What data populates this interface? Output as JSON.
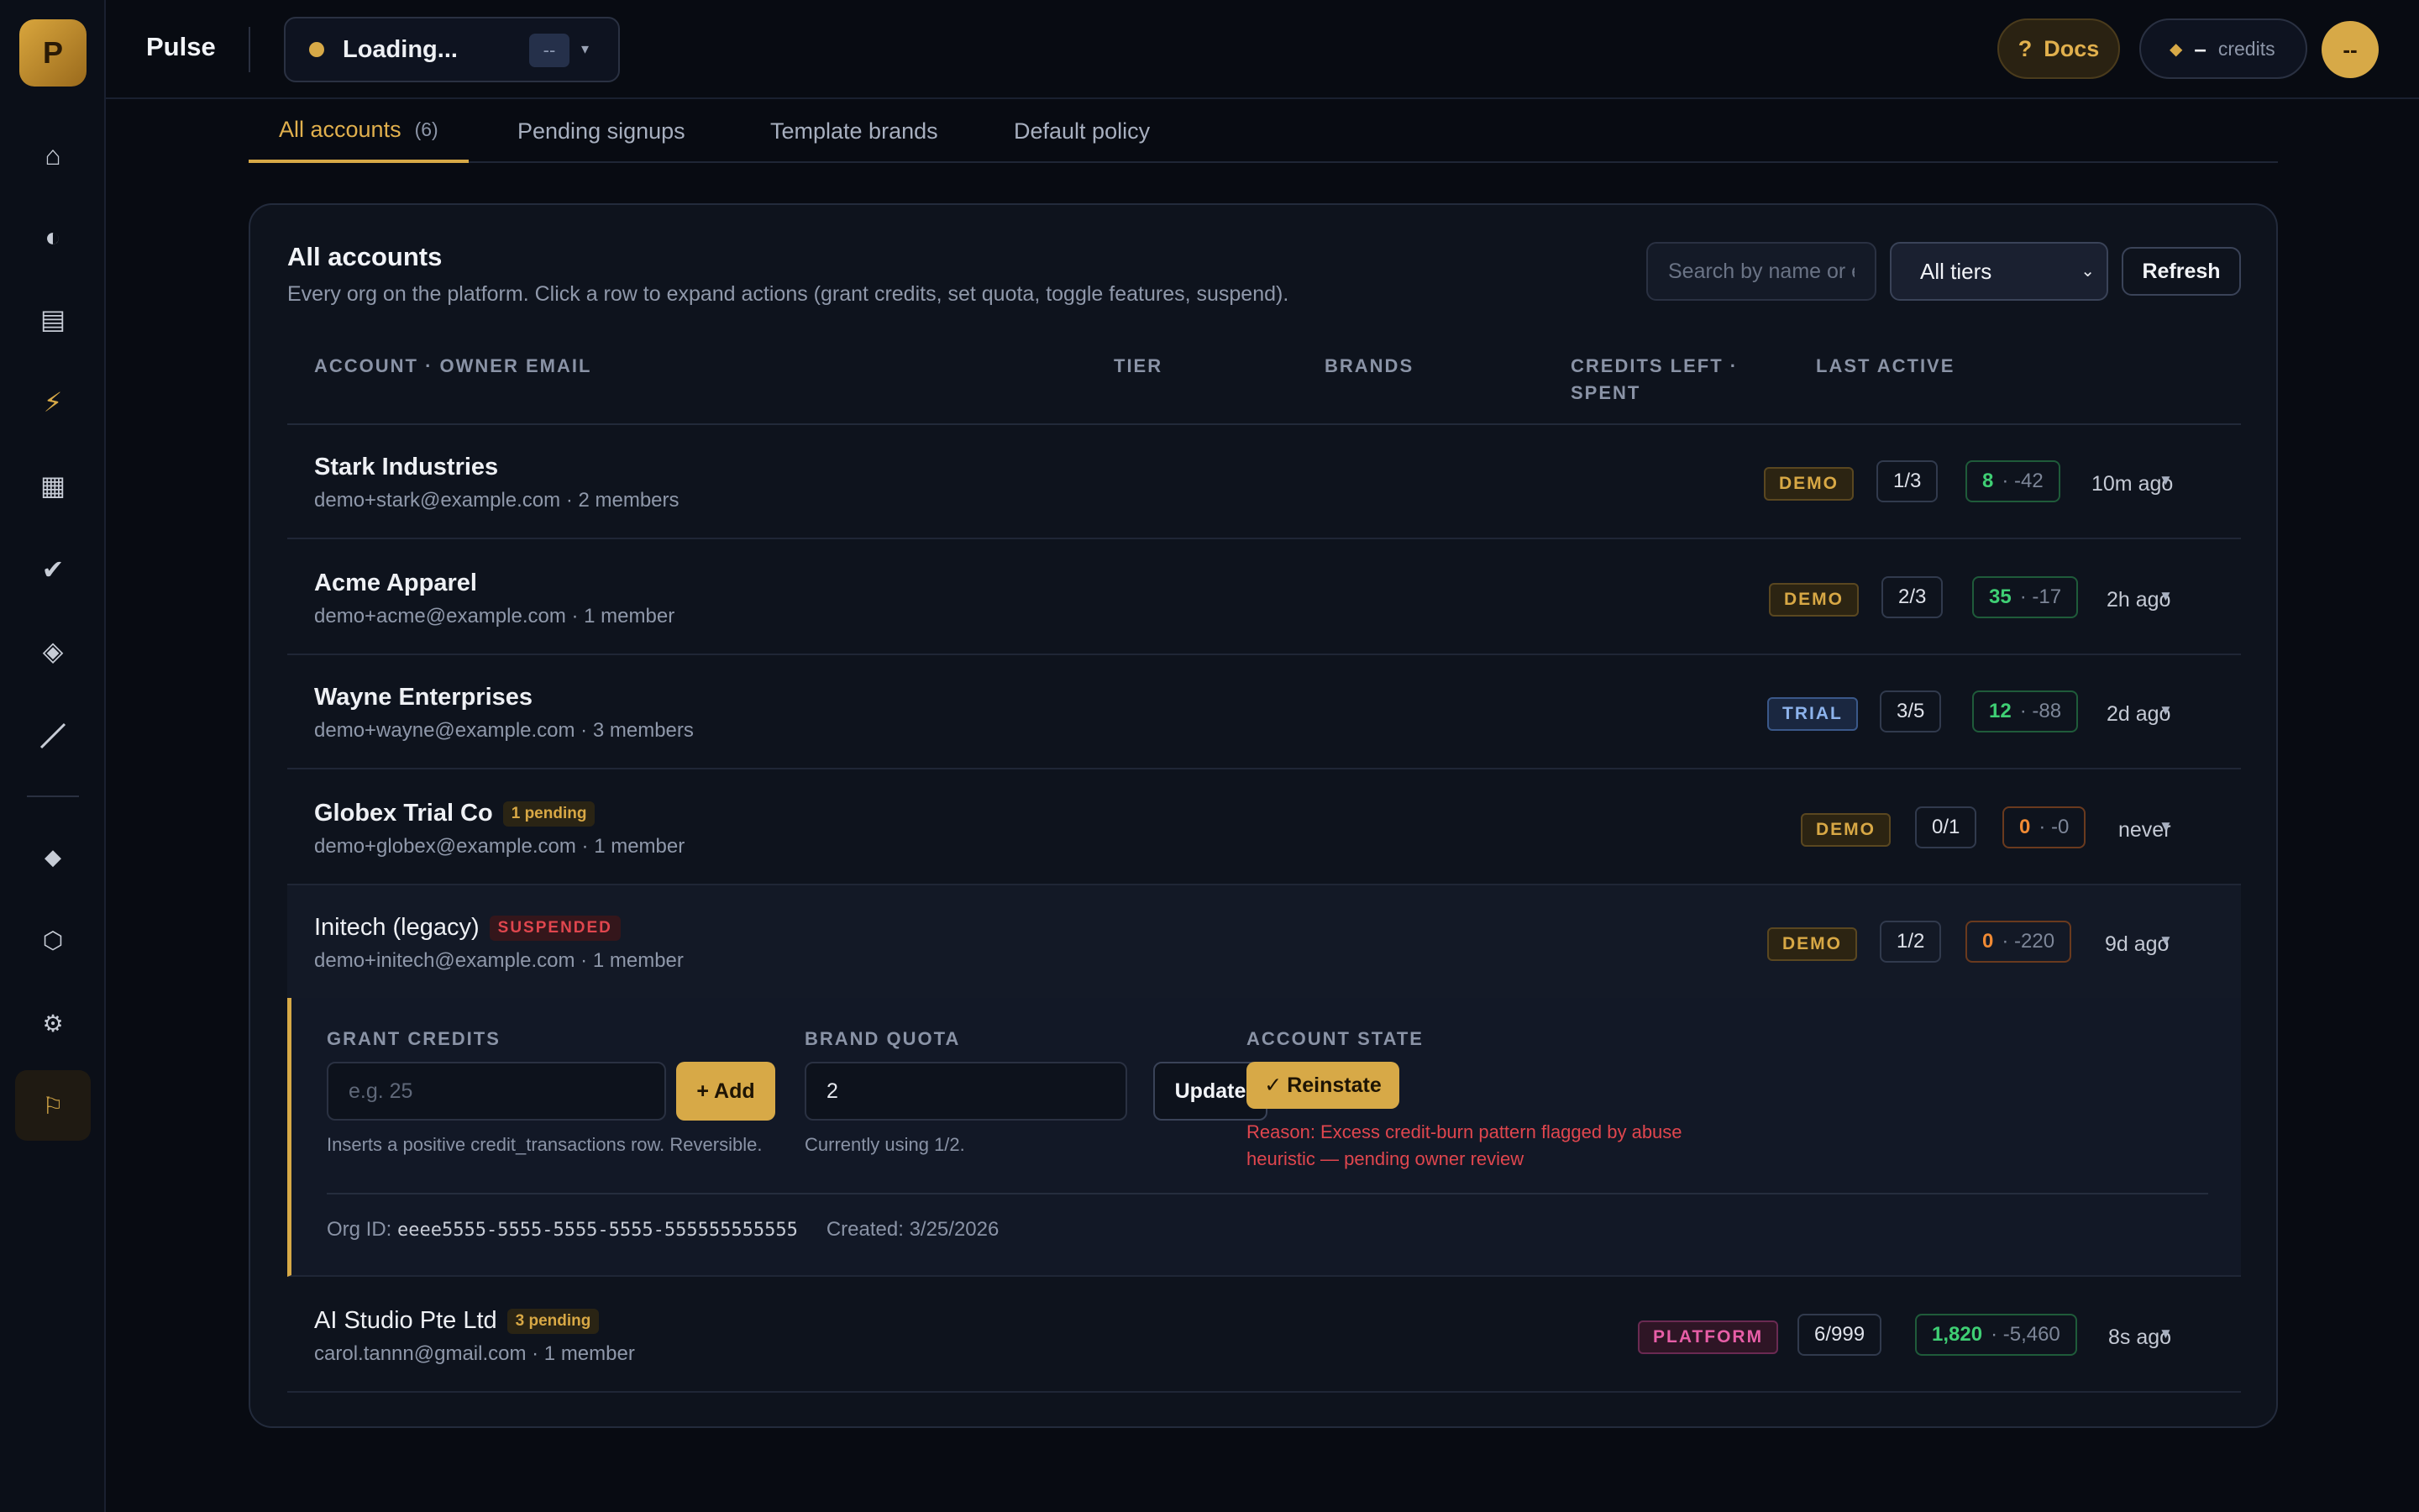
{
  "app": {
    "logo_letter": "P",
    "name": "Pulse"
  },
  "env": {
    "label": "Loading...",
    "badge": "--"
  },
  "topbar": {
    "docs_icon": "?",
    "docs_label": "Docs",
    "credits_value": "–",
    "credits_label": "credits",
    "avatar": "--"
  },
  "sidebar": {
    "icons": [
      "home-icon",
      "contrast-icon",
      "table-icon",
      "bolt-icon",
      "grid-icon",
      "check-icon",
      "layers-icon",
      "arrow-icon",
      "diamond-icon",
      "hexagon-icon",
      "gear-icon",
      "flag-icon"
    ],
    "active": "flag-icon"
  },
  "tabs": [
    {
      "label": "All accounts",
      "count": "(6)"
    },
    {
      "label": "Pending signups"
    },
    {
      "label": "Template brands"
    },
    {
      "label": "Default policy"
    }
  ],
  "card": {
    "title": "All accounts",
    "subtitle": "Every org on the platform. Click a row to expand actions (grant credits, set quota, toggle features, suspend).",
    "search_placeholder": "Search by name or email",
    "tier_filter": "All tiers",
    "refresh_label": "Refresh"
  },
  "columns": {
    "account": "ACCOUNT · OWNER EMAIL",
    "tier": "TIER",
    "brands": "BRANDS",
    "credits_l1": "CREDITS LEFT ·",
    "credits_l2": "SPENT",
    "last_active": "LAST ACTIVE"
  },
  "rows": [
    {
      "name": "Stark Industries",
      "email": "demo+stark@example.com · 2 members",
      "tier": "DEMO",
      "brands": "1/3",
      "credits_left": "8",
      "credits_spent": "· -42",
      "last_active": "10m ago"
    },
    {
      "name": "Acme Apparel",
      "email": "demo+acme@example.com · 1 member",
      "tier": "DEMO",
      "brands": "2/3",
      "credits_left": "35",
      "credits_spent": "· -17",
      "last_active": "2h ago"
    },
    {
      "name": "Wayne Enterprises",
      "email": "demo+wayne@example.com · 3 members",
      "tier": "TRIAL",
      "brands": "3/5",
      "credits_left": "12",
      "credits_spent": "· -88",
      "last_active": "2d ago"
    },
    {
      "name": "Globex Trial Co",
      "badge": "1 pending",
      "email": "demo+globex@example.com · 1 member",
      "tier": "DEMO",
      "brands": "0/1",
      "credits_left": "0",
      "credits_spent": "· -0",
      "last_active": "never"
    },
    {
      "name": "Initech (legacy)",
      "badge": "SUSPENDED",
      "email": "demo+initech@example.com · 1 member",
      "tier": "DEMO",
      "brands": "1/2",
      "credits_left": "0",
      "credits_spent": "· -220",
      "last_active": "9d ago"
    },
    {
      "name": "AI Studio Pte Ltd",
      "badge": "3 pending",
      "email": "carol.tannn@gmail.com · 1 member",
      "tier": "PLATFORM",
      "brands": "6/999",
      "credits_left": "1,820",
      "credits_spent": "· -5,460",
      "last_active": "8s ago"
    }
  ],
  "panel": {
    "grant_label": "GRANT CREDITS",
    "grant_placeholder": "e.g. 25",
    "add_label": "+ Add",
    "grant_hint": "Inserts a positive credit_transactions row. Reversible.",
    "quota_label": "BRAND QUOTA",
    "quota_value": "2",
    "update_label": "Update",
    "quota_hint": "Currently using 1/2.",
    "state_label": "ACCOUNT STATE",
    "reinstate_label": "Reinstate",
    "reason": "Reason: Excess credit-burn pattern flagged by abuse heuristic — pending owner review",
    "org_id_label": "Org ID:",
    "org_id": "eeee5555-5555-5555-5555-555555555555",
    "created": "Created: 3/25/2026"
  }
}
